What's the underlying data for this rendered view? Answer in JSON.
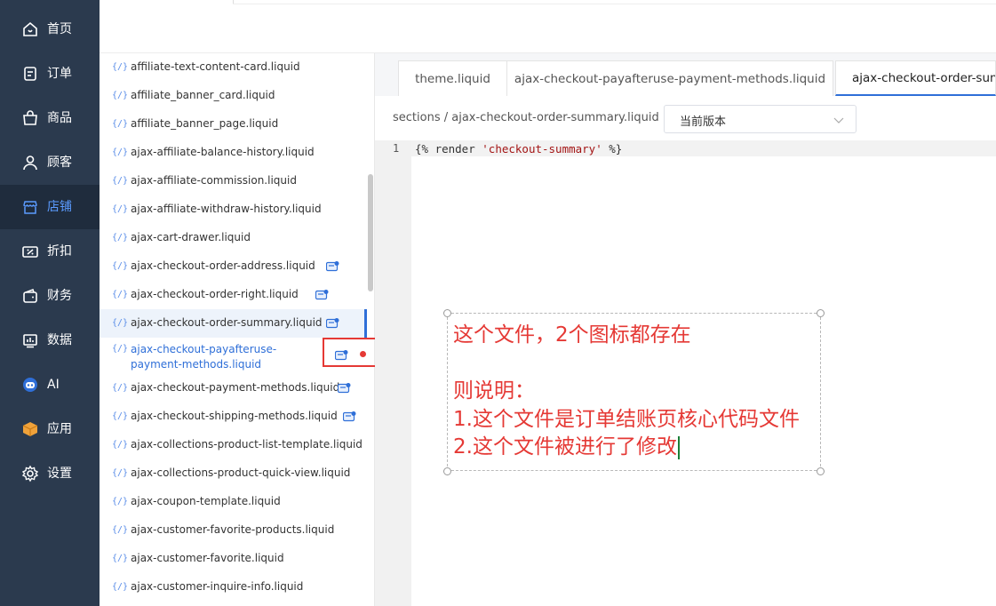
{
  "nav": [
    {
      "label": "首页",
      "icon": "home-icon"
    },
    {
      "label": "订单",
      "icon": "order-icon"
    },
    {
      "label": "商品",
      "icon": "bag-icon"
    },
    {
      "label": "顾客",
      "icon": "user-icon"
    },
    {
      "label": "店铺",
      "icon": "store-icon",
      "active": true
    },
    {
      "label": "折扣",
      "icon": "discount-icon"
    },
    {
      "label": "财务",
      "icon": "wallet-icon"
    },
    {
      "label": "数据",
      "icon": "chart-icon"
    },
    {
      "label": "AI",
      "icon": "robot-icon"
    },
    {
      "label": "应用",
      "icon": "box-icon"
    },
    {
      "label": "设置",
      "icon": "gear-icon"
    }
  ],
  "files": [
    {
      "name": "affiliate-text-content-card.liquid"
    },
    {
      "name": "affiliate_banner_card.liquid"
    },
    {
      "name": "affiliate_banner_page.liquid"
    },
    {
      "name": "ajax-affiliate-balance-history.liquid"
    },
    {
      "name": "ajax-affiliate-commission.liquid"
    },
    {
      "name": "ajax-affiliate-withdraw-history.liquid"
    },
    {
      "name": "ajax-cart-drawer.liquid"
    },
    {
      "name": "ajax-checkout-order-address.liquid",
      "badge": true
    },
    {
      "name": "ajax-checkout-order-right.liquid",
      "badge": true
    },
    {
      "name": "ajax-checkout-order-summary.liquid",
      "badge": true,
      "selected": true
    },
    {
      "name": "ajax-checkout-payafteruse-payment-methods.liquid",
      "badge": true,
      "modified": true
    },
    {
      "name": "ajax-checkout-payment-methods.liquid",
      "badge": true
    },
    {
      "name": "ajax-checkout-shipping-methods.liquid",
      "badge": true
    },
    {
      "name": "ajax-collections-product-list-template.liquid"
    },
    {
      "name": "ajax-collections-product-quick-view.liquid"
    },
    {
      "name": "ajax-coupon-template.liquid"
    },
    {
      "name": "ajax-customer-favorite-products.liquid"
    },
    {
      "name": "ajax-customer-favorite.liquid"
    },
    {
      "name": "ajax-customer-inquire-info.liquid"
    }
  ],
  "file_icon_glyph": "{/}",
  "tabs": [
    {
      "label": "theme.liquid"
    },
    {
      "label": "ajax-checkout-payafteruse-payment-methods.liquid"
    },
    {
      "label": "ajax-checkout-order-summary.liquid",
      "active": true
    }
  ],
  "breadcrumb": "sections / ajax-checkout-order-summary.liquid",
  "version_select": "当前版本",
  "editor": {
    "line_number": "1",
    "code_parts": [
      "{% render ",
      "'checkout-summary'",
      " %}"
    ]
  },
  "annotation": {
    "lines": [
      "这个文件，2个图标都存在",
      "",
      "则说明：",
      "1.这个文件是订单结账页核心代码文件",
      "2.这个文件被进行了修改"
    ]
  },
  "colors": {
    "nav_bg": "#2b3a4e",
    "accent": "#2f6fd8",
    "annotation": "#e53935"
  }
}
